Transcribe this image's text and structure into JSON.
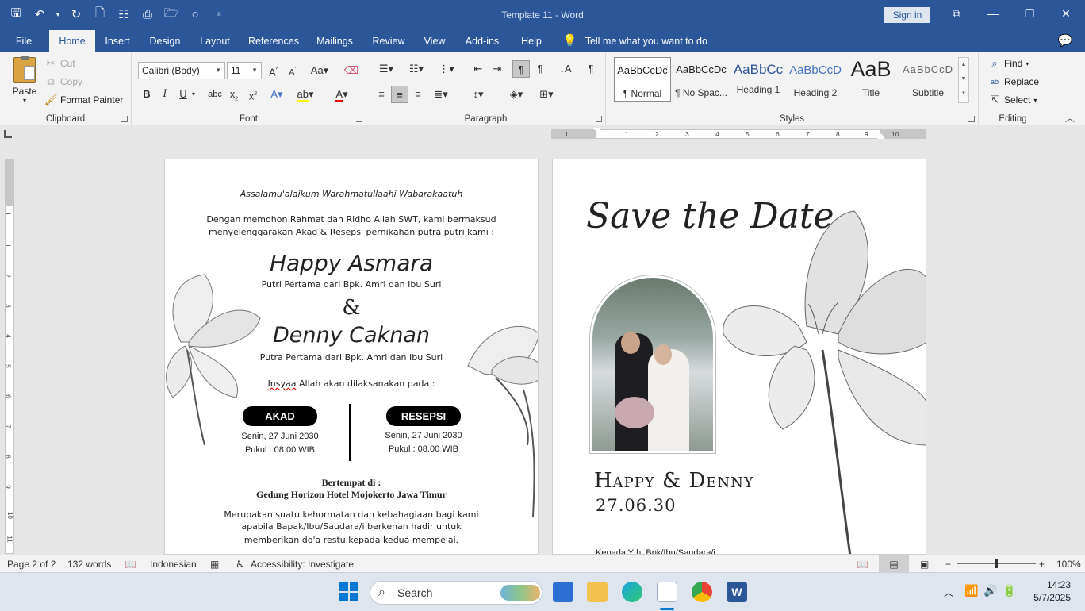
{
  "titlebar": {
    "doc_title": "Template 11  -  Word",
    "sign_in": "Sign in"
  },
  "tabs": [
    "File",
    "Home",
    "Insert",
    "Design",
    "Layout",
    "References",
    "Mailings",
    "Review",
    "View",
    "Add-ins",
    "Help"
  ],
  "tell_me": "Tell me what you want to do",
  "clipboard": {
    "paste": "Paste",
    "cut": "Cut",
    "copy": "Copy",
    "format_painter": "Format Painter",
    "label": "Clipboard"
  },
  "font": {
    "family": "Calibri (Body)",
    "size": "11",
    "label": "Font"
  },
  "paragraph": {
    "label": "Paragraph"
  },
  "styles": {
    "items": [
      {
        "sample": "AaBbCcDc",
        "name": "¶ Normal"
      },
      {
        "sample": "AaBbCcDc",
        "name": "¶ No Spac..."
      },
      {
        "sample": "AaBbCc",
        "name": "Heading 1"
      },
      {
        "sample": "AaBbCcD",
        "name": "Heading 2"
      },
      {
        "sample": "AaB",
        "name": "Title"
      },
      {
        "sample": "AaBbCcD",
        "name": "Subtitle"
      }
    ],
    "label": "Styles"
  },
  "editing": {
    "find": "Find",
    "replace": "Replace",
    "select": "Select",
    "label": "Editing"
  },
  "page1": {
    "greeting": "Assalamu'alaikum Warahmatullaahi Wabarakaatuh",
    "intro1": "Dengan memohon Rahmat dan Ridho Allah SWT, kami bermaksud",
    "intro2": "menyelenggarakan Akad & Resepsi pernikahan putra putri kami :",
    "bride": "Happy Asmara",
    "bride_parents": "Putri Pertama dari Bpk. Amri dan Ibu Suri",
    "amp": "&",
    "groom": "Denny Caknan",
    "groom_parents": "Putra Pertama dari Bpk. Amri dan Ibu Suri",
    "insyaa_word": "Insyaa",
    "insyaa_rest": " Allah akan dilaksanakan pada :",
    "akad": {
      "title": "AKAD",
      "date": "Senin, 27 Juni 2030",
      "time": "Pukul : 08.00 WIB"
    },
    "resepsi": {
      "title": "RESEPSI",
      "date": "Senin, 27 Juni 2030",
      "time": "Pukul : 08.00 WIB"
    },
    "venue_label": "Bertempat di :",
    "venue": "Gedung Horizon Hotel Mojokerto Jawa Timur",
    "closing1": "Merupakan suatu kehormatan dan kebahagiaan bagi kami",
    "closing2": "apabila Bapak/Ibu/Saudara/i berkenan hadir untuk",
    "closing3": "memberikan do'a restu kepada kedua mempelai."
  },
  "page2": {
    "save_the_date": "Save the Date",
    "couple": "Happy & Denny",
    "date": "27.06.30",
    "to": "Kepada Yth. Bpk/Ibu/Saudara/i :"
  },
  "status": {
    "page": "Page 2 of 2",
    "words": "132 words",
    "language": "Indonesian",
    "accessibility": "Accessibility: Investigate",
    "zoom": "100%"
  },
  "taskbar": {
    "search": "Search",
    "time": "14:23",
    "date": "5/7/2025"
  },
  "ruler": {
    "ticks": [
      "1",
      "1",
      "2",
      "3",
      "4",
      "5",
      "6",
      "7",
      "8",
      "9",
      "10"
    ],
    "vticks": [
      "1",
      "1",
      "2",
      "3",
      "4",
      "5",
      "6",
      "7",
      "8",
      "9",
      "10",
      "11"
    ]
  },
  "colors": {
    "word_blue": "#2b579a",
    "ribbon": "#f3f3f3",
    "heading_blue": "#4472c4"
  }
}
